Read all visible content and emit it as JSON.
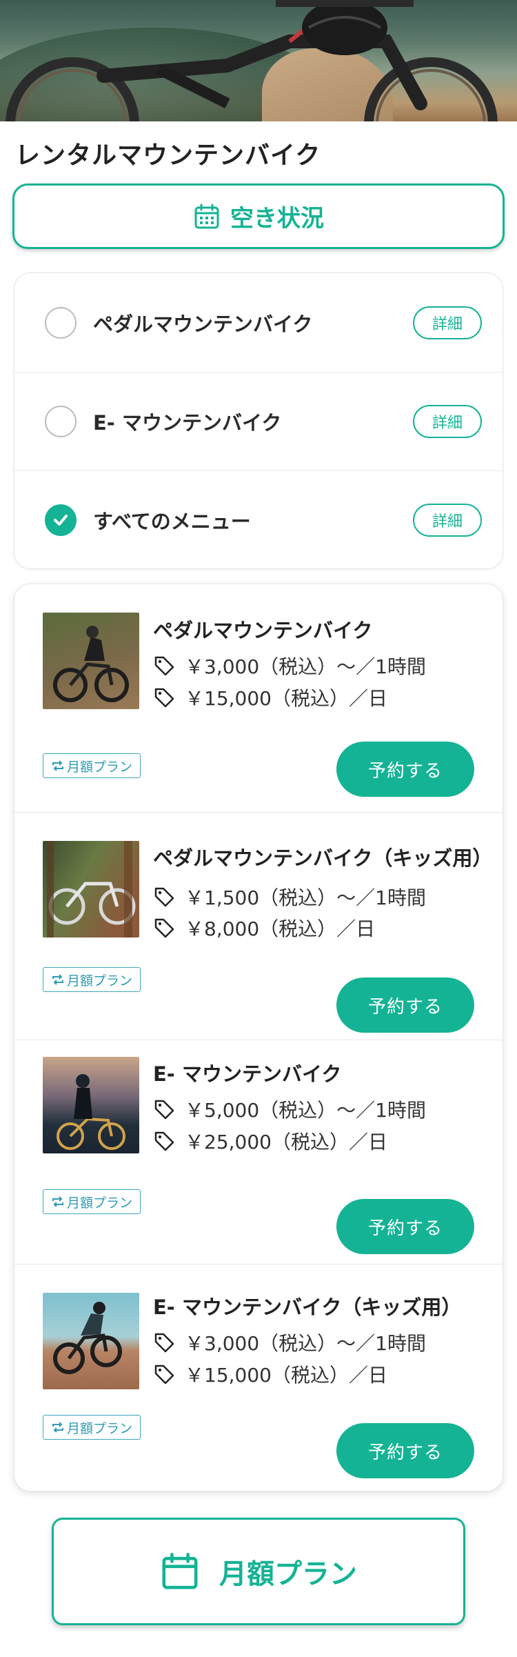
{
  "page": {
    "title": "レンタルマウンテンバイク"
  },
  "availability": {
    "label": "空き状況",
    "icon": "calendar-icon"
  },
  "filters": [
    {
      "label": "ペダルマウンテンバイク",
      "checked": false,
      "detail": "詳細"
    },
    {
      "label": "E- マウンテンバイク",
      "checked": false,
      "detail": "詳細"
    },
    {
      "label": "すべてのメニュー",
      "checked": true,
      "detail": "詳細"
    }
  ],
  "products": [
    {
      "name": "ペダルマウンテンバイク",
      "price_hour": "￥3,000（税込）〜／1時間",
      "price_day": "￥15,000（税込）／日",
      "plan": "月額プラン",
      "reserve": "予約する"
    },
    {
      "name": "ペダルマウンテンバイク（キッズ用）",
      "price_hour": "￥1,500（税込）〜／1時間",
      "price_day": "￥8,000（税込）／日",
      "plan": "月額プラン",
      "reserve": "予約する"
    },
    {
      "name": "E- マウンテンバイク",
      "price_hour": "￥5,000（税込）〜／1時間",
      "price_day": "￥25,000（税込）／日",
      "plan": "月額プラン",
      "reserve": "予約する"
    },
    {
      "name": "E- マウンテンバイク（キッズ用）",
      "price_hour": "￥3,000（税込）〜／1時間",
      "price_day": "￥15,000（税込）／日",
      "plan": "月額プラン",
      "reserve": "予約する"
    }
  ],
  "monthly_plan": {
    "label": "月額プラン",
    "icon": "calendar-icon"
  },
  "colors": {
    "accent": "#14b395",
    "badge": "#2f9bb5"
  }
}
